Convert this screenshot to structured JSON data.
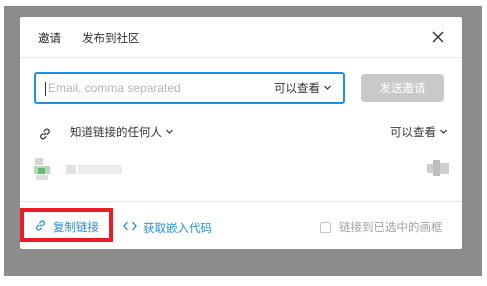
{
  "tabs": {
    "invite": "邀请",
    "publish": "发布到社区"
  },
  "invite": {
    "email_placeholder": "Email, comma separated",
    "permission": "可以查看",
    "send_label": "发送邀请"
  },
  "link_share": {
    "label": "知道链接的任何人",
    "permission": "可以查看"
  },
  "footer": {
    "copy_link": "复制链接",
    "embed_code": "获取嵌入代码",
    "link_selected_frame": "链接到已选中的画框"
  },
  "colors": {
    "accent": "#1f8fe0",
    "highlight_border": "#ea1c24",
    "disabled_button": "#c9c9c9"
  },
  "icons": [
    "close-icon",
    "chevron-down-icon",
    "link-icon",
    "code-icon",
    "checkbox"
  ]
}
